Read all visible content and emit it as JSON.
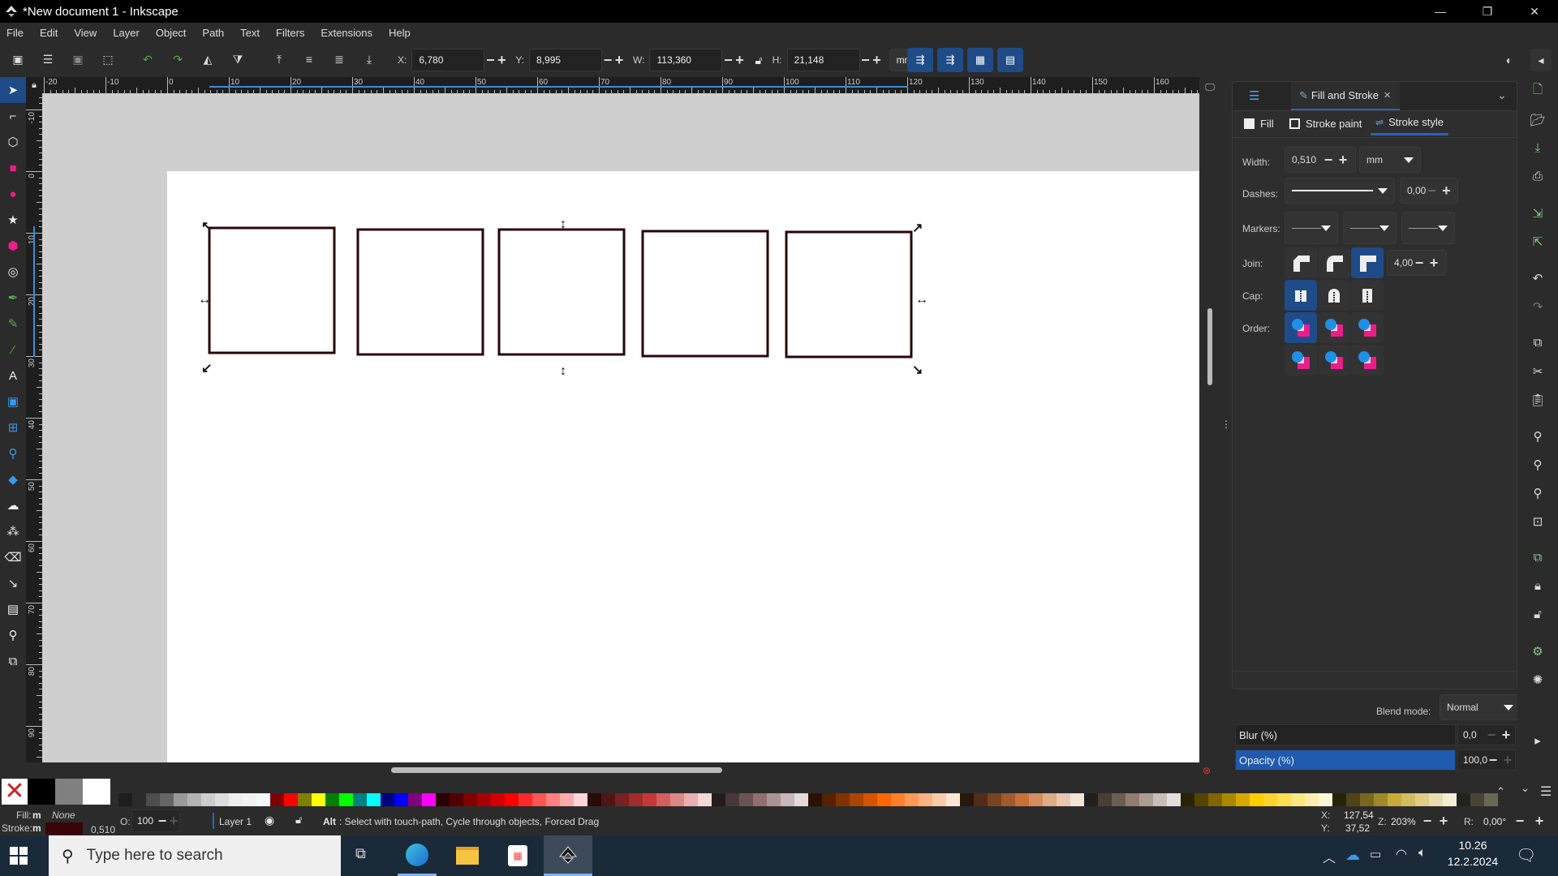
{
  "window": {
    "title": "*New document 1 - Inkscape",
    "controls": {
      "minimize": "—",
      "restore": "❐",
      "close": "✕"
    }
  },
  "menu": [
    "File",
    "Edit",
    "View",
    "Layer",
    "Object",
    "Path",
    "Text",
    "Filters",
    "Extensions",
    "Help"
  ],
  "toolbar": {
    "x_label": "X:",
    "x_value": "6,780",
    "y_label": "Y:",
    "y_value": "8,995",
    "w_label": "W:",
    "w_value": "113,360",
    "h_label": "H:",
    "h_value": "21,148",
    "unit": "mm",
    "minus": "−",
    "plus": "+"
  },
  "rulers": {
    "horizontal_ticks": [
      "-20",
      "-10",
      "0",
      "10",
      "20",
      "30",
      "40",
      "50",
      "60",
      "70",
      "80",
      "90",
      "100",
      "110",
      "120",
      "130",
      "140",
      "150",
      "160"
    ],
    "vertical_ticks": [
      "-10",
      "0",
      "10",
      "20",
      "30",
      "40",
      "50",
      "60",
      "70",
      "80",
      "90"
    ]
  },
  "tools": [
    {
      "name": "selector-tool",
      "glyph": "➤",
      "active": true
    },
    {
      "name": "node-tool",
      "glyph": "⌐"
    },
    {
      "name": "shape-builder-tool",
      "glyph": "⬡"
    },
    {
      "name": "rectangle-tool",
      "glyph": "■"
    },
    {
      "name": "ellipse-tool",
      "glyph": "●"
    },
    {
      "name": "star-tool",
      "glyph": "★"
    },
    {
      "name": "3d-box-tool",
      "glyph": "⬢"
    },
    {
      "name": "spiral-tool",
      "glyph": "◎"
    },
    {
      "name": "bezier-tool",
      "glyph": "✒"
    },
    {
      "name": "pencil-tool",
      "glyph": "✎"
    },
    {
      "name": "calligraphy-tool",
      "glyph": "⁄"
    },
    {
      "name": "text-tool",
      "glyph": "A"
    },
    {
      "name": "gradient-tool",
      "glyph": "▣"
    },
    {
      "name": "mesh-tool",
      "glyph": "⊞"
    },
    {
      "name": "dropper-tool",
      "glyph": "⚲"
    },
    {
      "name": "paint-bucket-tool",
      "glyph": "◆"
    },
    {
      "name": "tweak-tool",
      "glyph": "☁"
    },
    {
      "name": "spray-tool",
      "glyph": "⁂"
    },
    {
      "name": "eraser-tool",
      "glyph": "⌫"
    },
    {
      "name": "connector-tool",
      "glyph": "↘"
    },
    {
      "name": "measure-tool",
      "glyph": "▤"
    },
    {
      "name": "zoom-tool",
      "glyph": "⚲"
    },
    {
      "name": "pages-tool",
      "glyph": "⧉"
    }
  ],
  "canvas": {
    "rectangles": 5,
    "stroke_color": "#2a0508",
    "fill": "None"
  },
  "dock": {
    "tab_title": "Fill and Stroke",
    "tab_close": "✕",
    "subtabs": [
      {
        "label": "Fill",
        "active": false
      },
      {
        "label": "Stroke paint",
        "active": false
      },
      {
        "label": "Stroke style",
        "active": true
      }
    ],
    "width_label": "Width:",
    "width_value": "0,510",
    "width_unit": "mm",
    "dashes_label": "Dashes:",
    "dash_offset": "0,00",
    "markers_label": "Markers:",
    "join_label": "Join:",
    "miter_limit": "4,00",
    "join_selected": "miter",
    "cap_label": "Cap:",
    "cap_selected": "butt",
    "order_label": "Order:",
    "order_selected": 1,
    "blend_label": "Blend mode:",
    "blend_value": "Normal",
    "blur_label": "Blur (%)",
    "blur_value": "0,0",
    "opacity_label": "Opacity (%)",
    "opacity_value": "100,0",
    "opacity_fraction": 1.0
  },
  "palette": {
    "swatches": [
      "#000000",
      "#808080",
      "#ffffff",
      "#1e1e1e",
      "#2b2b2b",
      "#4d4d4d",
      "#666666",
      "#999999",
      "#b3b3b3",
      "#cccccc",
      "#dddddd",
      "#eeeeee",
      "#f2f2f2",
      "#f8f8f8",
      "#800000",
      "#ff0000",
      "#808000",
      "#ffff00",
      "#008000",
      "#00ff00",
      "#008080",
      "#00ffff",
      "#000080",
      "#0000ff",
      "#800080",
      "#ff00ff",
      "#2b0000",
      "#550000",
      "#800000",
      "#aa0000",
      "#d40000",
      "#ff0000",
      "#ff2a2a",
      "#ff5555",
      "#ff8080",
      "#ffaaaa",
      "#ffd5d5",
      "#280b0b",
      "#501616",
      "#782121",
      "#a02c2c",
      "#c83737",
      "#d35f5f",
      "#de8787",
      "#e9afaf",
      "#f4d7d7",
      "#241c1c",
      "#483737",
      "#6c5353",
      "#916f6f",
      "#ac9393",
      "#c8b7b7",
      "#e3dbdb",
      "#2b1100",
      "#552200",
      "#803300",
      "#aa4400",
      "#d45500",
      "#ff6600",
      "#ff7f2a",
      "#ff9955",
      "#ffb380",
      "#ffccaa",
      "#ffe6d5",
      "#28170b",
      "#502d16",
      "#784421",
      "#a05a2c",
      "#c87137",
      "#d38d5f",
      "#deaa87",
      "#e9c6af",
      "#f4e3d7",
      "#241f1c",
      "#483e37",
      "#6c5d53",
      "#917c6f",
      "#ac9d93",
      "#c8beb7",
      "#e3dedb",
      "#2b2200",
      "#554400",
      "#806600",
      "#aa8800",
      "#d4aa00",
      "#ffcc00",
      "#ffd42a",
      "#ffdd55",
      "#ffe680",
      "#ffeeaa",
      "#fff6d5",
      "#28220b",
      "#504416",
      "#786721",
      "#a0892c",
      "#c8ab37",
      "#d3bc5f",
      "#decd87",
      "#e9ddaf",
      "#f4eed7",
      "#24221c",
      "#484537",
      "#6c6753"
    ]
  },
  "status": {
    "fill_label": "Fill:",
    "fill_mode": "m",
    "fill_value": "None",
    "stroke_label": "Stroke:",
    "stroke_mode": "m",
    "stroke_color": "#3a0508",
    "stroke_width": "0,510",
    "opacity_label": "O:",
    "opacity_value": "100",
    "layer": "Layer 1",
    "message_key": "Alt",
    "message": ": Select with touch-path, Cycle through objects, Forced Drag",
    "cursor_x_label": "X:",
    "cursor_x": "127,54",
    "cursor_y_label": "Y:",
    "cursor_y": "37,52",
    "zoom_label": "Z:",
    "zoom_value": "203%",
    "rotation_label": "R:",
    "rotation_value": "0,00°"
  },
  "taskbar": {
    "search_placeholder": "Type here to search",
    "time": "10.26",
    "date": "12.2.2024"
  },
  "commands": [
    "new-document",
    "open-document",
    "save-document",
    "print-document",
    "import",
    "export",
    "undo",
    "redo",
    "duplicate",
    "cut",
    "paste",
    "zoom-selection",
    "zoom-drawing",
    "zoom-page",
    "zoom-center",
    "group",
    "lock",
    "unlock",
    "xml-editor",
    "filters",
    "more"
  ]
}
